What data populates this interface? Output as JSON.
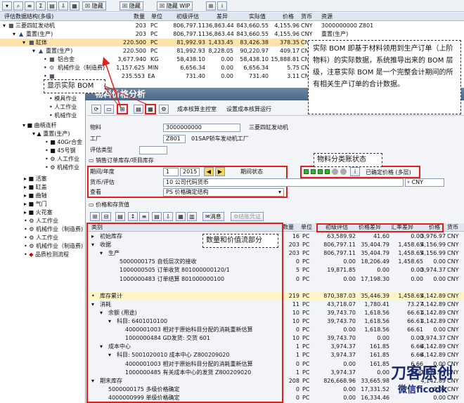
{
  "toolbar": {
    "hide1": "隐藏",
    "hide2": "隐藏",
    "hide_wip": "隐藏 WIP"
  },
  "tree_header": {
    "col_structure": "评估数据结构(多级)",
    "col_qty": "数量",
    "col_unit": "单位",
    "col_initial": "初级评估",
    "col_diff": "差异",
    "col_actual": "实际值",
    "col_price": "价格",
    "col_currency": "货币",
    "col_resource": "资源"
  },
  "tree_rows": [
    {
      "label": "三菱四缸发动机",
      "qty": "203",
      "unit": "PC",
      "initial": "806,797.11",
      "diff": "36,863.44",
      "actual": "843,660.55",
      "price": "4,155.96",
      "cur": "CNY",
      "res": "3000000000 Z801"
    },
    {
      "label": "重置(生产)",
      "qty": "203",
      "unit": "PC",
      "initial": "806,797.11",
      "diff": "36,863.44",
      "actual": "843,660.55",
      "price": "4,155.96",
      "cur": "CNY",
      "res": "重置(生产)"
    },
    {
      "label": "缸体",
      "qty": "220.500",
      "unit": "PC",
      "initial": "81,992.93",
      "diff": "1,433.45",
      "actual": "83,426.38",
      "price": "378.35",
      "cur": "CN",
      "res": ""
    },
    {
      "label": "重置(生产)",
      "qty": "220.500",
      "unit": "PC",
      "initial": "81,992.93",
      "diff": "8,228.05",
      "actual": "90,220.97",
      "price": "409.17",
      "cur": "CN",
      "res": ""
    },
    {
      "label": "铝合金",
      "qty": "3,677.940",
      "unit": "KG",
      "initial": "58,438.10",
      "diff": "0.00",
      "actual": "58,438.10",
      "price": "15,888.81",
      "cur": "CN",
      "res": ""
    },
    {
      "label": "机械作业（制造费)",
      "qty": "1,157.625",
      "unit": "MIN",
      "initial": "6,656.34",
      "diff": "0.00",
      "actual": "6,656.34",
      "price": "5.75",
      "cur": "CN",
      "res": ""
    },
    {
      "label": "",
      "qty": "235.553",
      "unit": "EA",
      "initial": "731.40",
      "diff": "0.00",
      "actual": "731.40",
      "price": "3.11",
      "cur": "CNY",
      "res": ""
    }
  ],
  "left_tree": [
    "模具作业",
    "人工作业",
    "机械作业",
    "曲柄连杆",
    "重置(生产)",
    "40Gr合金",
    "45号钢",
    "人工作业",
    "机械作业",
    "活塞",
    "缸盖",
    "曲轴",
    "气门",
    "火花塞",
    "人工作业",
    "机械作业（制造费)",
    "人工作业",
    "机械作业（制造费)",
    "品质检测流程"
  ],
  "callouts": {
    "bom_note": "实际 BOM 即基于材料领用到生产订单（上阶物料）的实际数据，系统推导出来的 BOM 层级，注意实际 BOM 是一个完整会计期间的所有相关生产订单的合计数据。",
    "show_bom": "显示实际 BOM",
    "status_note": "物料分类账状态",
    "qty_value_note": "数量和价值流部分"
  },
  "panel": {
    "title": "物料价格分析",
    "tab_costing_cockpit": "成本核算主控室",
    "tab_set_costing_run": "设置成本核算运行",
    "material_label": "物料",
    "material_value": "3000000000",
    "material_desc": "三菱四缸发动机",
    "plant_label": "工厂",
    "plant_value": "Z801",
    "plant_desc": "01SAP轿车发动机工厂",
    "valuation_type_label": "评估类型",
    "sales_stock_label": "销售订单库存/项目库存",
    "period_label": "期间/年度",
    "period_value": "1",
    "year_value": "2015",
    "period_status_label": "期间状态",
    "status_text": "已确定价格 (多层)",
    "currency_label": "货币/评估",
    "currency_value": "10 公司代码货币",
    "currency_code": "CNY",
    "view_label": "查看",
    "view_value": "PS 价格确定结构",
    "section_title": "价格和存货值",
    "message_btn": "消息",
    "post_btn": "结账凭证"
  },
  "grid_header": {
    "col_category": "类别",
    "col_qty": "数量",
    "col_unit": "单位",
    "col_initial": "初级评估",
    "col_price_diff": "价格差异",
    "col_fx_diff": "汇率差异",
    "col_price": "价格",
    "col_currency": "货币"
  },
  "grid_rows": [
    {
      "label": "初始库存",
      "qty": "16",
      "unit": "PC",
      "initial": "63,589.92",
      "pdiff": "41.60",
      "fx": "0.00",
      "price": "3,976.97",
      "cur": "CNY",
      "sum": false
    },
    {
      "label": "收据",
      "qty": "203",
      "unit": "PC",
      "initial": "806,797.11",
      "pdiff": "35,404.79",
      "fx": "1,458.65",
      "price": "4,156.99",
      "cur": "CNY",
      "sum": false
    },
    {
      "label": "生产",
      "qty": "203",
      "unit": "PC",
      "initial": "806,797.11",
      "pdiff": "35,404.79",
      "fx": "1,458.65",
      "price": "4,156.99",
      "cur": "CNY",
      "sum": false
    },
    {
      "label": "5000000175 自低层次的接收",
      "qty": "0",
      "unit": "PC",
      "initial": "0.00",
      "pdiff": "18,206.49",
      "fx": "1,458.65",
      "price": "0.00",
      "cur": "CNY",
      "sum": false
    },
    {
      "label": "1000000505 订单收货 801000000120/1",
      "qty": "5",
      "unit": "PC",
      "initial": "19,871.85",
      "pdiff": "0.00",
      "fx": "0.00",
      "price": "3,974.37",
      "cur": "CNY",
      "sum": false
    },
    {
      "label": "1000000483 订单结算 801000000100",
      "qty": "0",
      "unit": "PC",
      "initial": "0.00",
      "pdiff": "17,198.30",
      "fx": "0.00",
      "price": "0.00",
      "cur": "CNY",
      "sum": false
    },
    {
      "label": "",
      "qty": "",
      "unit": "",
      "initial": "",
      "pdiff": "",
      "fx": "",
      "price": "",
      "cur": "",
      "sum": false
    },
    {
      "label": "库存累计",
      "qty": "219",
      "unit": "PC",
      "initial": "870,387.03",
      "pdiff": "35,446.39",
      "fx": "1,458.65",
      "price": "4,142.89",
      "cur": "CNY",
      "sum": true
    },
    {
      "label": "消耗",
      "qty": "11",
      "unit": "PC",
      "initial": "43,718.07",
      "pdiff": "1,780.41",
      "fx": "73.27",
      "price": "4,142.89",
      "cur": "CNY",
      "sum": false
    },
    {
      "label": "余额 (用途)",
      "qty": "10",
      "unit": "PC",
      "initial": "39,743.70",
      "pdiff": "1,618.56",
      "fx": "66.61",
      "price": "4,142.89",
      "cur": "CNY",
      "sum": false
    },
    {
      "label": "科目: 6401010100",
      "qty": "10",
      "unit": "PC",
      "initial": "39,743.70",
      "pdiff": "1,618.56",
      "fx": "66.61",
      "price": "4,142.89",
      "cur": "CNY",
      "sum": false
    },
    {
      "label": "4000001003 相对于原始科目分配的消耗重新估算",
      "qty": "0",
      "unit": "PC",
      "initial": "0.00",
      "pdiff": "1,618.56",
      "fx": "66.61",
      "price": "0.00",
      "cur": "CNY",
      "sum": false
    },
    {
      "label": "1000000484 GD发货: 交货 601",
      "qty": "10",
      "unit": "PC",
      "initial": "39,743.70",
      "pdiff": "0.00",
      "fx": "0.00",
      "price": "3,974.37",
      "cur": "CNY",
      "sum": false
    },
    {
      "label": "成本中心",
      "qty": "1",
      "unit": "PC",
      "initial": "3,974.37",
      "pdiff": "161.85",
      "fx": "6.66",
      "price": "4,142.89",
      "cur": "CNY",
      "sum": false
    },
    {
      "label": "科目: 5001020010 成本中心 Z800209020",
      "qty": "1",
      "unit": "PC",
      "initial": "3,974.37",
      "pdiff": "161.85",
      "fx": "6.66",
      "price": "4,142.89",
      "cur": "CNY",
      "sum": false
    },
    {
      "label": "4000001003 相对于原始科目分配的消耗重新估算",
      "qty": "0",
      "unit": "PC",
      "initial": "0.00",
      "pdiff": "161.85",
      "fx": "6.66",
      "price": "0.00",
      "cur": "CNY",
      "sum": false
    },
    {
      "label": "1000000485 有关成本中心的发货 Z800209020",
      "qty": "1",
      "unit": "PC",
      "initial": "3,974.37",
      "pdiff": "0.00",
      "fx": "0.00",
      "price": "3,974.37",
      "cur": "CNY",
      "sum": false
    },
    {
      "label": "期末库存",
      "qty": "208",
      "unit": "PC",
      "initial": "826,668.96",
      "pdiff": "33,665.98",
      "fx": "",
      "price": "4,142.89",
      "cur": "CNY",
      "sum": false
    },
    {
      "label": "5000000175 多级价格确定",
      "qty": "0",
      "unit": "PC",
      "initial": "0.00",
      "pdiff": "17,331.52",
      "fx": "",
      "price": "0.00",
      "cur": "CNY",
      "sum": false
    },
    {
      "label": "4000000999 单级价格确定",
      "qty": "0",
      "unit": "PC",
      "initial": "0.00",
      "pdiff": "16,334.46",
      "fx": "",
      "price": "0.00",
      "cur": "CNY",
      "sum": false
    }
  ],
  "watermark": {
    "line1": "刀客原创",
    "line2": "微信ficodk"
  },
  "colors": {
    "highlight": "#ffe3a6",
    "red_box": "#e0201a",
    "title_bar": "#4b6788",
    "status_green": "#2fb52f"
  }
}
